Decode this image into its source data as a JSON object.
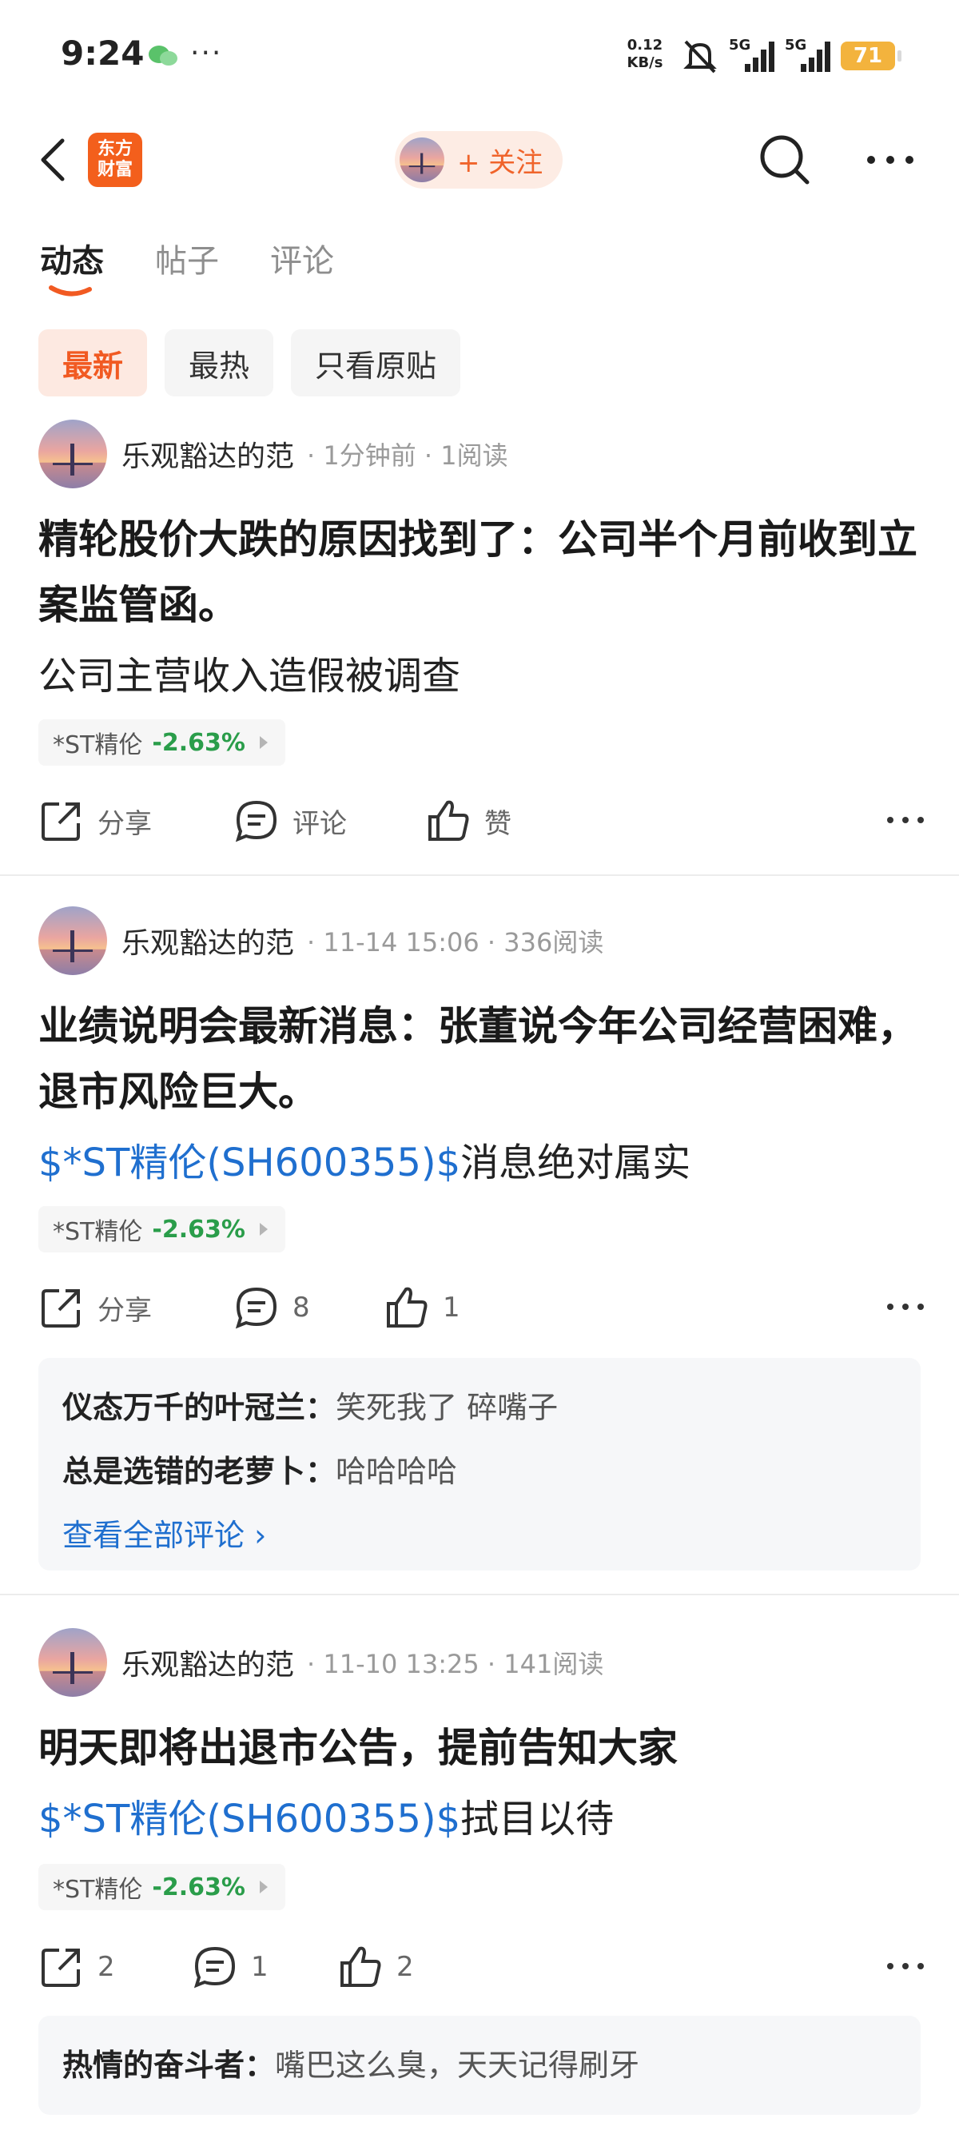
{
  "status_bar": {
    "time": "9:24",
    "net_speed": "0.12",
    "net_unit": "KB/s",
    "signal1": "5G",
    "signal2": "5G",
    "battery": "71"
  },
  "header": {
    "logo_line1": "东方",
    "logo_line2": "财富",
    "follow_label": "+ 关注"
  },
  "tabs": [
    "动态",
    "帖子",
    "评论"
  ],
  "filters": [
    "最新",
    "最热",
    "只看原贴"
  ],
  "posts": [
    {
      "author": "乐观豁达的范",
      "meta": "· 1分钟前 · 1阅读",
      "title": "精轮股价大跌的原因找到了：公司半个月前收到立案监管函。",
      "body": "公司主营收入造假被调查",
      "stock_name": "*ST精伦",
      "stock_change": "-2.63%",
      "share": "分享",
      "comment": "评论",
      "like": "赞"
    },
    {
      "author": "乐观豁达的范",
      "meta": "· 11-14 15:06 · 336阅读",
      "title": "业绩说明会最新消息：张董说今年公司经营困难，退市风险巨大。",
      "body_link": "$*ST精伦(SH600355)$",
      "body": "消息绝对属实",
      "stock_name": "*ST精伦",
      "stock_change": "-2.63%",
      "share": "分享",
      "comment": "8",
      "like": "1",
      "comments": [
        {
          "user": "仪态万千的叶冠兰：",
          "text": "笑死我了 碎嘴子"
        },
        {
          "user": "总是选错的老萝卜：",
          "text": "哈哈哈哈"
        }
      ],
      "view_all": "查看全部评论 ›"
    },
    {
      "author": "乐观豁达的范",
      "meta": "· 11-10 13:25 · 141阅读",
      "title": "明天即将出退市公告，提前告知大家",
      "body_link": "$*ST精伦(SH600355)$",
      "body": "拭目以待",
      "stock_name": "*ST精伦",
      "stock_change": "-2.63%",
      "share": "2",
      "comment": "1",
      "like": "2",
      "comments": [
        {
          "user": "热情的奋斗者：",
          "text": "嘴巴这么臭，天天记得刷牙"
        }
      ]
    }
  ],
  "colors": {
    "accent": "#f15a22",
    "link": "#1f6fcf",
    "down": "#2a9d4a"
  }
}
